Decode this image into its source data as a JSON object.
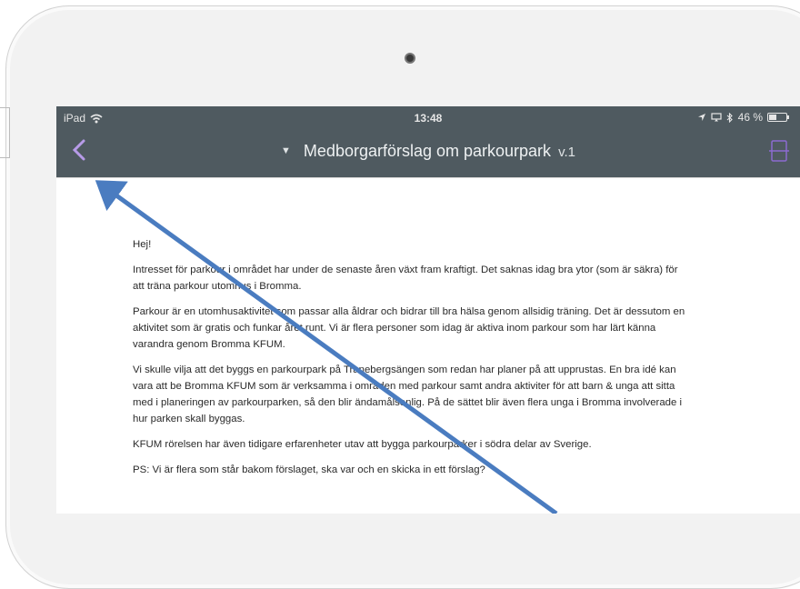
{
  "status_bar": {
    "device": "iPad",
    "time": "13:48",
    "battery": "46 %",
    "battery_level": 0.46
  },
  "navbar": {
    "title": "Medborgarförslag om parkourpark",
    "version": "v.1"
  },
  "document": {
    "paragraphs": [
      "Hej!",
      "Intresset för parkour i området har under de senaste åren växt fram kraftigt. Det saknas idag bra ytor (som är säkra) för att träna parkour utomhus i Bromma.",
      "Parkour är en utomhusaktivitet som passar alla åldrar och bidrar till bra hälsa genom allsidig träning. Det är dessutom en aktivitet som är gratis och funkar året runt. Vi är flera personer som idag är aktiva inom parkour som har lärt känna varandra genom Bromma KFUM.",
      "Vi skulle vilja att det byggs en parkourpark på Tranebergsängen som redan har planer på att upprustas. En bra idé kan vara att be Bromma KFUM som är verksamma i områden med parkour samt andra aktiviter för att barn & unga att sitta med i planeringen av parkourparken, så den blir ändamålsenlig. På de sättet blir även flera unga i Bromma involverade i hur parken skall byggas.",
      "KFUM rörelsen har även tidigare erfarenheter utav att bygga parkourparker i södra delar av Sverige.",
      "PS: Vi är flera som står bakom förslaget, ska var och en skicka in ett förslag?"
    ]
  },
  "colors": {
    "header": "#4f5a60",
    "back_arrow": "#b79be8",
    "annotation_arrow": "#4a7cc0"
  },
  "icons": {
    "wifi": "wifi-icon",
    "location": "location-arrow-icon",
    "screen": "screen-mirror-icon",
    "bluetooth": "bluetooth-icon",
    "battery": "battery-icon",
    "back": "chevron-left-icon",
    "document": "document-icon"
  }
}
